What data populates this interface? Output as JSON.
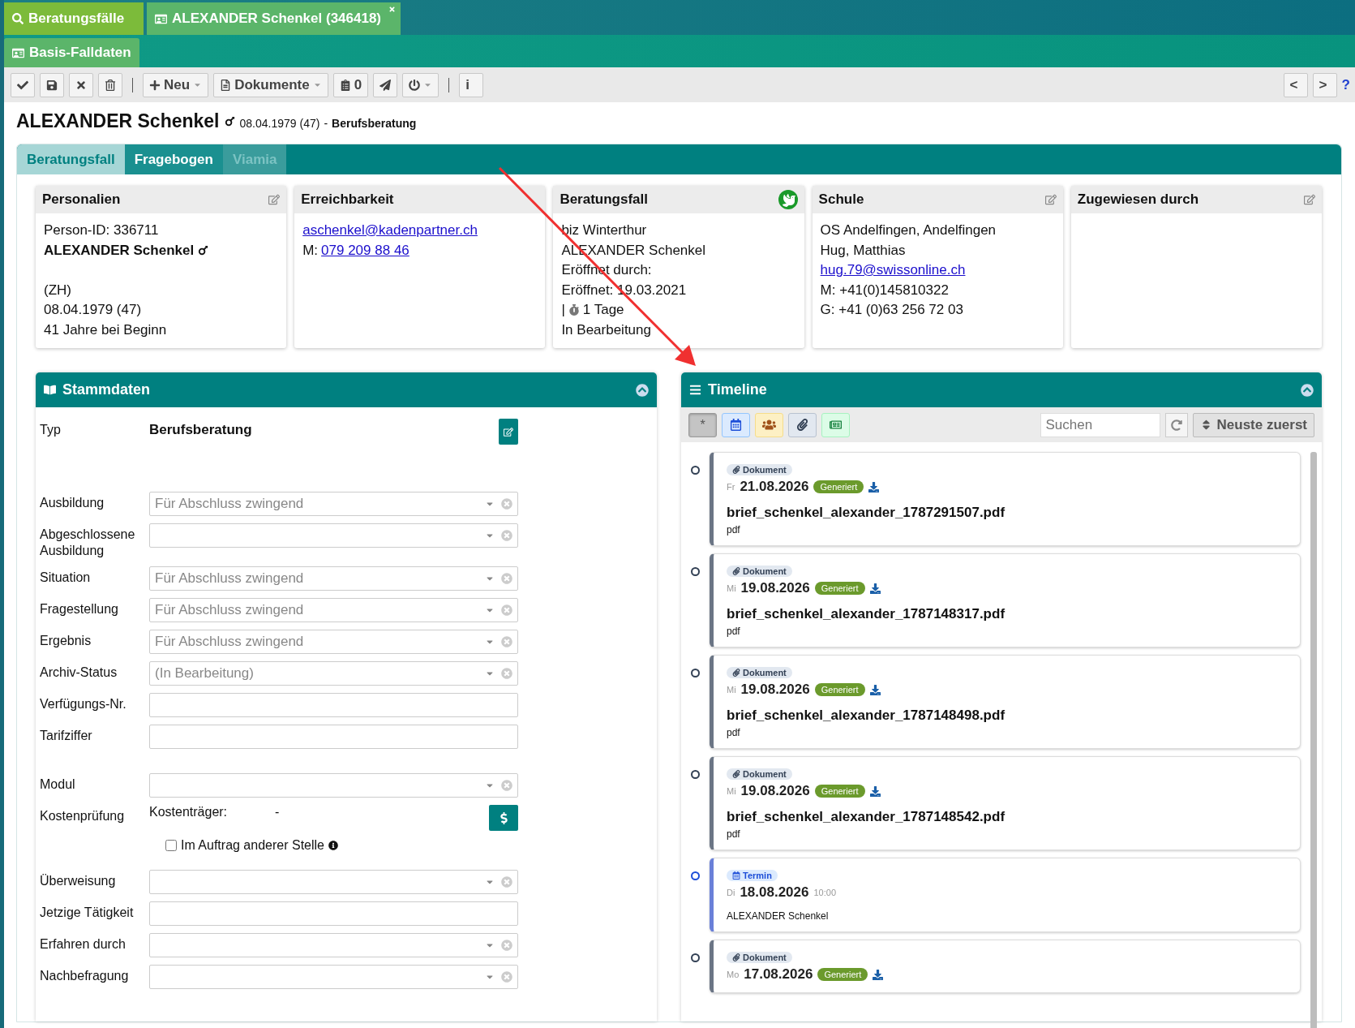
{
  "top_tabs": [
    {
      "kind": "search",
      "label": "Beratungsfälle",
      "selected": false
    },
    {
      "kind": "case",
      "label": "ALEXANDER Schenkel (346418)",
      "selected": true
    }
  ],
  "sub_tabs": [
    {
      "label": "Basis-Falldaten",
      "selected": true
    }
  ],
  "toolbar": {
    "left": [
      {
        "kind": "check"
      },
      {
        "kind": "save"
      },
      {
        "kind": "cancel"
      },
      {
        "kind": "trash"
      },
      {
        "kind": "separator"
      },
      {
        "kind": "new",
        "label": "Neu"
      },
      {
        "kind": "documents",
        "label": "Dokumente"
      },
      {
        "kind": "count",
        "label": "0"
      },
      {
        "kind": "send"
      },
      {
        "kind": "power"
      },
      {
        "kind": "separator"
      },
      {
        "kind": "text",
        "label": "i"
      }
    ],
    "right": [
      {
        "kind": "text",
        "label": "<"
      },
      {
        "kind": "text",
        "label": ">"
      },
      {
        "kind": "help",
        "label": "?"
      }
    ]
  },
  "person": {
    "name": "ALEXANDER Schenkel",
    "birth": "08.04.1979 (47)",
    "separator": "-",
    "case_type": "Berufsberatung"
  },
  "content_tabs": [
    {
      "label": "Beratungsfall",
      "selected": true,
      "disabled": false
    },
    {
      "label": "Fragebogen",
      "selected": false,
      "disabled": false
    },
    {
      "label": "Viamia",
      "selected": false,
      "disabled": true
    }
  ],
  "cards": [
    {
      "kind": "editable",
      "title": "Personalien",
      "lines": [
        {
          "kind": "text",
          "text": "Person-ID: 336711"
        },
        {
          "kind": "bold",
          "text": "ALEXANDER Schenkel"
        },
        {
          "kind": "after_blank",
          "text": "(ZH)"
        },
        {
          "kind": "text",
          "text": "08.04.1979 (47)"
        },
        {
          "kind": "text",
          "text": "41 Jahre bei Beginn"
        }
      ]
    },
    {
      "kind": "plain",
      "title": "Erreichbarkeit",
      "lines": [
        {
          "kind": "link",
          "text": "aschenkel@kadenpartner.ch"
        },
        {
          "kind": "labeled_link",
          "label": "M:",
          "text": "079 209 88 46"
        }
      ]
    },
    {
      "kind": "status",
      "title": "Beratungsfall",
      "lines": [
        {
          "kind": "text",
          "text": "biz Winterthur"
        },
        {
          "kind": "text",
          "text": "ALEXANDER Schenkel"
        },
        {
          "kind": "text",
          "text": "Eröffnet durch:"
        },
        {
          "kind": "text",
          "text": "Eröffnet: 19.03.2021"
        },
        {
          "kind": "duration",
          "label": "|",
          "text": "1 Tage"
        },
        {
          "kind": "text",
          "text": "In Bearbeitung"
        }
      ]
    },
    {
      "kind": "editable",
      "title": "Schule",
      "lines": [
        {
          "kind": "text",
          "text": "OS Andelfingen, Andelfingen"
        },
        {
          "kind": "text",
          "text": "Hug, Matthias"
        },
        {
          "kind": "link",
          "text": "hug.79@swissonline.ch"
        },
        {
          "kind": "text",
          "text": "M: +41(0)145810322"
        },
        {
          "kind": "text",
          "text": "G: +41 (0)63 256 72 03"
        }
      ]
    },
    {
      "kind": "editable",
      "title": "Zugewiesen durch"
    }
  ],
  "stammdaten": {
    "title": "Stammdaten",
    "sections": [
      [
        {
          "kind": "static",
          "label": "Typ",
          "value": "Berufsberatung"
        }
      ],
      [
        {
          "kind": "select",
          "label": "Ausbildung",
          "placeholder": "Für Abschluss zwingend"
        },
        {
          "kind": "select",
          "label": "Abgeschlossene Ausbildung"
        },
        {
          "kind": "select",
          "label": "Situation",
          "placeholder": "Für Abschluss zwingend"
        },
        {
          "kind": "select",
          "label": "Fragestellung",
          "placeholder": "Für Abschluss zwingend"
        },
        {
          "kind": "select",
          "label": "Ergebnis",
          "placeholder": "Für Abschluss zwingend"
        },
        {
          "kind": "select",
          "label": "Archiv-Status",
          "placeholder": "(In Bearbeitung)"
        },
        {
          "kind": "text",
          "label": "Verfügungs-Nr."
        },
        {
          "kind": "text",
          "label": "Tarifziffer"
        }
      ],
      [
        {
          "kind": "select",
          "label": "Modul"
        },
        {
          "kind": "cost",
          "label": "Kostenprüfung",
          "sublabel": "Kostenträger:",
          "value": "-"
        },
        {
          "kind": "checkbox",
          "label": "Im Auftrag anderer Stelle",
          "checked": false
        },
        {
          "kind": "select",
          "label": "Überweisung"
        },
        {
          "kind": "text",
          "label": "Jetzige Tätigkeit"
        },
        {
          "kind": "select",
          "label": "Erfahren durch"
        },
        {
          "kind": "select",
          "label": "Nachbefragung"
        }
      ]
    ]
  },
  "timeline": {
    "title": "Timeline",
    "filters": [
      {
        "kind": "all",
        "label": "*",
        "selected": true
      },
      {
        "kind": "appointment",
        "selected": false
      },
      {
        "kind": "meeting",
        "selected": false
      },
      {
        "kind": "document",
        "selected": false
      },
      {
        "kind": "note",
        "selected": false
      }
    ],
    "search": {
      "placeholder": "Suchen"
    },
    "sort": "Neuste zuerst",
    "items": [
      {
        "kind": "document",
        "tag": "Dokument",
        "weekday": "Fr",
        "date": "21.08.2026",
        "badge": "Generiert",
        "title": "brief_schenkel_alexander_1787291507.pdf",
        "subtitle": "pdf"
      },
      {
        "kind": "document",
        "tag": "Dokument",
        "weekday": "Mi",
        "date": "19.08.2026",
        "badge": "Generiert",
        "title": "brief_schenkel_alexander_1787148317.pdf",
        "subtitle": "pdf"
      },
      {
        "kind": "document",
        "tag": "Dokument",
        "weekday": "Mi",
        "date": "19.08.2026",
        "badge": "Generiert",
        "title": "brief_schenkel_alexander_1787148498.pdf",
        "subtitle": "pdf"
      },
      {
        "kind": "document",
        "tag": "Dokument",
        "weekday": "Mi",
        "date": "19.08.2026",
        "badge": "Generiert",
        "title": "brief_schenkel_alexander_1787148542.pdf",
        "subtitle": "pdf"
      },
      {
        "kind": "appointment",
        "tag": "Termin",
        "weekday": "Di",
        "date": "18.08.2026",
        "time": "10:00",
        "subtitle": "ALEXANDER Schenkel"
      },
      {
        "kind": "document",
        "tag": "Dokument",
        "weekday": "Mo",
        "date": "17.08.2026",
        "badge": "Generiert"
      }
    ]
  }
}
